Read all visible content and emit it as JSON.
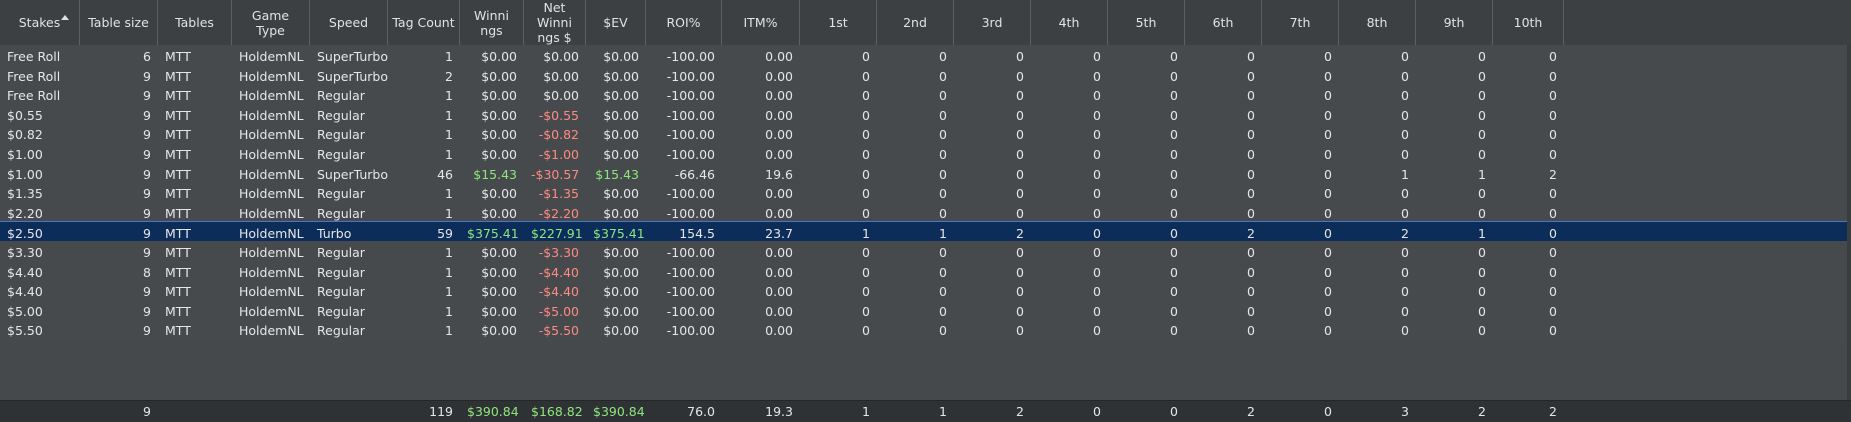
{
  "columns": [
    {
      "key": "stakes",
      "label": "Stakes",
      "sorted": "asc"
    },
    {
      "key": "table_size",
      "label": "Table size"
    },
    {
      "key": "tables",
      "label": "Tables"
    },
    {
      "key": "game_type",
      "label": "Game\nType"
    },
    {
      "key": "speed",
      "label": "Speed"
    },
    {
      "key": "tag_count",
      "label": "Tag Count"
    },
    {
      "key": "winnings",
      "label": "Winni\nngs"
    },
    {
      "key": "net_winnings",
      "label": "Net\nWinni\nngs $"
    },
    {
      "key": "ev",
      "label": "$EV"
    },
    {
      "key": "roi",
      "label": "ROI%"
    },
    {
      "key": "itm",
      "label": "ITM%"
    },
    {
      "key": "p1",
      "label": "1st"
    },
    {
      "key": "p2",
      "label": "2nd"
    },
    {
      "key": "p3",
      "label": "3rd"
    },
    {
      "key": "p4",
      "label": "4th"
    },
    {
      "key": "p5",
      "label": "5th"
    },
    {
      "key": "p6",
      "label": "6th"
    },
    {
      "key": "p7",
      "label": "7th"
    },
    {
      "key": "p8",
      "label": "8th"
    },
    {
      "key": "p9",
      "label": "9th"
    },
    {
      "key": "p10",
      "label": "10th"
    }
  ],
  "rows": [
    {
      "stakes": "Free Roll",
      "table_size": "6",
      "tables": "MTT",
      "game_type": "HoldemNL",
      "speed": "SuperTurbo",
      "tag_count": "1",
      "winnings": "$0.00",
      "net_winnings": "$0.00",
      "ev": "$0.00",
      "roi": "-100.00",
      "itm": "0.00",
      "p1": "0",
      "p2": "0",
      "p3": "0",
      "p4": "0",
      "p5": "0",
      "p6": "0",
      "p7": "0",
      "p8": "0",
      "p9": "0",
      "p10": "0"
    },
    {
      "stakes": "Free Roll",
      "table_size": "9",
      "tables": "MTT",
      "game_type": "HoldemNL",
      "speed": "SuperTurbo",
      "tag_count": "2",
      "winnings": "$0.00",
      "net_winnings": "$0.00",
      "ev": "$0.00",
      "roi": "-100.00",
      "itm": "0.00",
      "p1": "0",
      "p2": "0",
      "p3": "0",
      "p4": "0",
      "p5": "0",
      "p6": "0",
      "p7": "0",
      "p8": "0",
      "p9": "0",
      "p10": "0"
    },
    {
      "stakes": "Free Roll",
      "table_size": "9",
      "tables": "MTT",
      "game_type": "HoldemNL",
      "speed": "Regular",
      "tag_count": "1",
      "winnings": "$0.00",
      "net_winnings": "$0.00",
      "ev": "$0.00",
      "roi": "-100.00",
      "itm": "0.00",
      "p1": "0",
      "p2": "0",
      "p3": "0",
      "p4": "0",
      "p5": "0",
      "p6": "0",
      "p7": "0",
      "p8": "0",
      "p9": "0",
      "p10": "0"
    },
    {
      "stakes": "$0.55",
      "table_size": "9",
      "tables": "MTT",
      "game_type": "HoldemNL",
      "speed": "Regular",
      "tag_count": "1",
      "winnings": "$0.00",
      "net_winnings": "-$0.55",
      "ev": "$0.00",
      "roi": "-100.00",
      "itm": "0.00",
      "p1": "0",
      "p2": "0",
      "p3": "0",
      "p4": "0",
      "p5": "0",
      "p6": "0",
      "p7": "0",
      "p8": "0",
      "p9": "0",
      "p10": "0"
    },
    {
      "stakes": "$0.82",
      "table_size": "9",
      "tables": "MTT",
      "game_type": "HoldemNL",
      "speed": "Regular",
      "tag_count": "1",
      "winnings": "$0.00",
      "net_winnings": "-$0.82",
      "ev": "$0.00",
      "roi": "-100.00",
      "itm": "0.00",
      "p1": "0",
      "p2": "0",
      "p3": "0",
      "p4": "0",
      "p5": "0",
      "p6": "0",
      "p7": "0",
      "p8": "0",
      "p9": "0",
      "p10": "0"
    },
    {
      "stakes": "$1.00",
      "table_size": "9",
      "tables": "MTT",
      "game_type": "HoldemNL",
      "speed": "Regular",
      "tag_count": "1",
      "winnings": "$0.00",
      "net_winnings": "-$1.00",
      "ev": "$0.00",
      "roi": "-100.00",
      "itm": "0.00",
      "p1": "0",
      "p2": "0",
      "p3": "0",
      "p4": "0",
      "p5": "0",
      "p6": "0",
      "p7": "0",
      "p8": "0",
      "p9": "0",
      "p10": "0"
    },
    {
      "stakes": "$1.00",
      "table_size": "9",
      "tables": "MTT",
      "game_type": "HoldemNL",
      "speed": "SuperTurbo",
      "tag_count": "46",
      "winnings": "$15.43",
      "net_winnings": "-$30.57",
      "ev": "$15.43",
      "roi": "-66.46",
      "itm": "19.6",
      "p1": "0",
      "p2": "0",
      "p3": "0",
      "p4": "0",
      "p5": "0",
      "p6": "0",
      "p7": "0",
      "p8": "1",
      "p9": "1",
      "p10": "2"
    },
    {
      "stakes": "$1.35",
      "table_size": "9",
      "tables": "MTT",
      "game_type": "HoldemNL",
      "speed": "Regular",
      "tag_count": "1",
      "winnings": "$0.00",
      "net_winnings": "-$1.35",
      "ev": "$0.00",
      "roi": "-100.00",
      "itm": "0.00",
      "p1": "0",
      "p2": "0",
      "p3": "0",
      "p4": "0",
      "p5": "0",
      "p6": "0",
      "p7": "0",
      "p8": "0",
      "p9": "0",
      "p10": "0"
    },
    {
      "stakes": "$2.20",
      "table_size": "9",
      "tables": "MTT",
      "game_type": "HoldemNL",
      "speed": "Regular",
      "tag_count": "1",
      "winnings": "$0.00",
      "net_winnings": "-$2.20",
      "ev": "$0.00",
      "roi": "-100.00",
      "itm": "0.00",
      "p1": "0",
      "p2": "0",
      "p3": "0",
      "p4": "0",
      "p5": "0",
      "p6": "0",
      "p7": "0",
      "p8": "0",
      "p9": "0",
      "p10": "0"
    },
    {
      "stakes": "$2.50",
      "table_size": "9",
      "tables": "MTT",
      "game_type": "HoldemNL",
      "speed": "Turbo",
      "tag_count": "59",
      "winnings": "$375.41",
      "net_winnings": "$227.91",
      "ev": "$375.41",
      "roi": "154.5",
      "itm": "23.7",
      "p1": "1",
      "p2": "1",
      "p3": "2",
      "p4": "0",
      "p5": "0",
      "p6": "2",
      "p7": "0",
      "p8": "2",
      "p9": "1",
      "p10": "0",
      "selected": true
    },
    {
      "stakes": "$3.30",
      "table_size": "9",
      "tables": "MTT",
      "game_type": "HoldemNL",
      "speed": "Regular",
      "tag_count": "1",
      "winnings": "$0.00",
      "net_winnings": "-$3.30",
      "ev": "$0.00",
      "roi": "-100.00",
      "itm": "0.00",
      "p1": "0",
      "p2": "0",
      "p3": "0",
      "p4": "0",
      "p5": "0",
      "p6": "0",
      "p7": "0",
      "p8": "0",
      "p9": "0",
      "p10": "0"
    },
    {
      "stakes": "$4.40",
      "table_size": "8",
      "tables": "MTT",
      "game_type": "HoldemNL",
      "speed": "Regular",
      "tag_count": "1",
      "winnings": "$0.00",
      "net_winnings": "-$4.40",
      "ev": "$0.00",
      "roi": "-100.00",
      "itm": "0.00",
      "p1": "0",
      "p2": "0",
      "p3": "0",
      "p4": "0",
      "p5": "0",
      "p6": "0",
      "p7": "0",
      "p8": "0",
      "p9": "0",
      "p10": "0"
    },
    {
      "stakes": "$4.40",
      "table_size": "9",
      "tables": "MTT",
      "game_type": "HoldemNL",
      "speed": "Regular",
      "tag_count": "1",
      "winnings": "$0.00",
      "net_winnings": "-$4.40",
      "ev": "$0.00",
      "roi": "-100.00",
      "itm": "0.00",
      "p1": "0",
      "p2": "0",
      "p3": "0",
      "p4": "0",
      "p5": "0",
      "p6": "0",
      "p7": "0",
      "p8": "0",
      "p9": "0",
      "p10": "0"
    },
    {
      "stakes": "$5.00",
      "table_size": "9",
      "tables": "MTT",
      "game_type": "HoldemNL",
      "speed": "Regular",
      "tag_count": "1",
      "winnings": "$0.00",
      "net_winnings": "-$5.00",
      "ev": "$0.00",
      "roi": "-100.00",
      "itm": "0.00",
      "p1": "0",
      "p2": "0",
      "p3": "0",
      "p4": "0",
      "p5": "0",
      "p6": "0",
      "p7": "0",
      "p8": "0",
      "p9": "0",
      "p10": "0"
    },
    {
      "stakes": "$5.50",
      "table_size": "9",
      "tables": "MTT",
      "game_type": "HoldemNL",
      "speed": "Regular",
      "tag_count": "1",
      "winnings": "$0.00",
      "net_winnings": "-$5.50",
      "ev": "$0.00",
      "roi": "-100.00",
      "itm": "0.00",
      "p1": "0",
      "p2": "0",
      "p3": "0",
      "p4": "0",
      "p5": "0",
      "p6": "0",
      "p7": "0",
      "p8": "0",
      "p9": "0",
      "p10": "0"
    }
  ],
  "totals": {
    "stakes": "",
    "table_size": "9",
    "tables": "",
    "game_type": "",
    "speed": "",
    "tag_count": "119",
    "winnings": "$390.84",
    "net_winnings": "$168.82",
    "ev": "$390.84",
    "roi": "76.0",
    "itm": "19.3",
    "p1": "1",
    "p2": "1",
    "p3": "2",
    "p4": "0",
    "p5": "0",
    "p6": "2",
    "p7": "0",
    "p8": "3",
    "p9": "2",
    "p10": "2"
  },
  "colors": {
    "positive": "#8ee67e",
    "negative": "#ff8a80",
    "selected_row": "#0c2c5a"
  }
}
